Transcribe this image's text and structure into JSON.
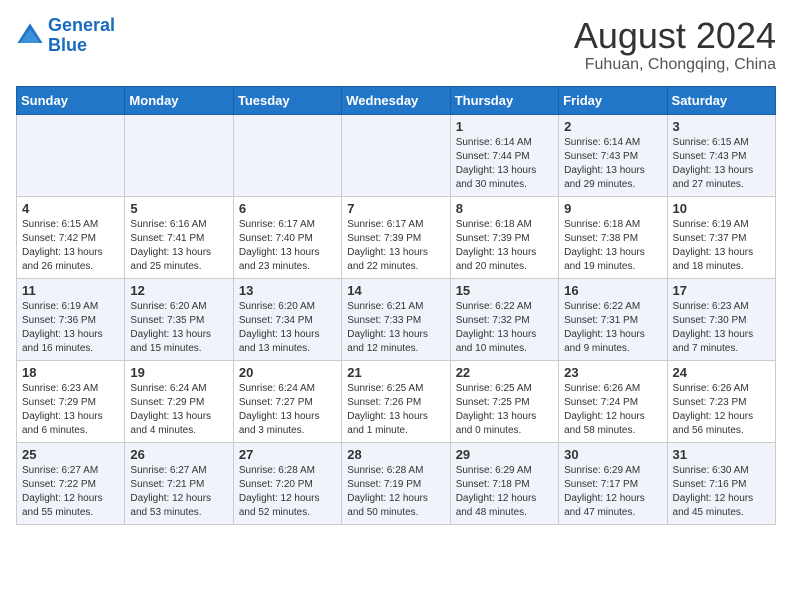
{
  "header": {
    "logo_line1": "General",
    "logo_line2": "Blue",
    "month_year": "August 2024",
    "location": "Fuhuan, Chongqing, China"
  },
  "weekdays": [
    "Sunday",
    "Monday",
    "Tuesday",
    "Wednesday",
    "Thursday",
    "Friday",
    "Saturday"
  ],
  "weeks": [
    [
      {
        "day": "",
        "info": ""
      },
      {
        "day": "",
        "info": ""
      },
      {
        "day": "",
        "info": ""
      },
      {
        "day": "",
        "info": ""
      },
      {
        "day": "1",
        "info": "Sunrise: 6:14 AM\nSunset: 7:44 PM\nDaylight: 13 hours\nand 30 minutes."
      },
      {
        "day": "2",
        "info": "Sunrise: 6:14 AM\nSunset: 7:43 PM\nDaylight: 13 hours\nand 29 minutes."
      },
      {
        "day": "3",
        "info": "Sunrise: 6:15 AM\nSunset: 7:43 PM\nDaylight: 13 hours\nand 27 minutes."
      }
    ],
    [
      {
        "day": "4",
        "info": "Sunrise: 6:15 AM\nSunset: 7:42 PM\nDaylight: 13 hours\nand 26 minutes."
      },
      {
        "day": "5",
        "info": "Sunrise: 6:16 AM\nSunset: 7:41 PM\nDaylight: 13 hours\nand 25 minutes."
      },
      {
        "day": "6",
        "info": "Sunrise: 6:17 AM\nSunset: 7:40 PM\nDaylight: 13 hours\nand 23 minutes."
      },
      {
        "day": "7",
        "info": "Sunrise: 6:17 AM\nSunset: 7:39 PM\nDaylight: 13 hours\nand 22 minutes."
      },
      {
        "day": "8",
        "info": "Sunrise: 6:18 AM\nSunset: 7:39 PM\nDaylight: 13 hours\nand 20 minutes."
      },
      {
        "day": "9",
        "info": "Sunrise: 6:18 AM\nSunset: 7:38 PM\nDaylight: 13 hours\nand 19 minutes."
      },
      {
        "day": "10",
        "info": "Sunrise: 6:19 AM\nSunset: 7:37 PM\nDaylight: 13 hours\nand 18 minutes."
      }
    ],
    [
      {
        "day": "11",
        "info": "Sunrise: 6:19 AM\nSunset: 7:36 PM\nDaylight: 13 hours\nand 16 minutes."
      },
      {
        "day": "12",
        "info": "Sunrise: 6:20 AM\nSunset: 7:35 PM\nDaylight: 13 hours\nand 15 minutes."
      },
      {
        "day": "13",
        "info": "Sunrise: 6:20 AM\nSunset: 7:34 PM\nDaylight: 13 hours\nand 13 minutes."
      },
      {
        "day": "14",
        "info": "Sunrise: 6:21 AM\nSunset: 7:33 PM\nDaylight: 13 hours\nand 12 minutes."
      },
      {
        "day": "15",
        "info": "Sunrise: 6:22 AM\nSunset: 7:32 PM\nDaylight: 13 hours\nand 10 minutes."
      },
      {
        "day": "16",
        "info": "Sunrise: 6:22 AM\nSunset: 7:31 PM\nDaylight: 13 hours\nand 9 minutes."
      },
      {
        "day": "17",
        "info": "Sunrise: 6:23 AM\nSunset: 7:30 PM\nDaylight: 13 hours\nand 7 minutes."
      }
    ],
    [
      {
        "day": "18",
        "info": "Sunrise: 6:23 AM\nSunset: 7:29 PM\nDaylight: 13 hours\nand 6 minutes."
      },
      {
        "day": "19",
        "info": "Sunrise: 6:24 AM\nSunset: 7:29 PM\nDaylight: 13 hours\nand 4 minutes."
      },
      {
        "day": "20",
        "info": "Sunrise: 6:24 AM\nSunset: 7:27 PM\nDaylight: 13 hours\nand 3 minutes."
      },
      {
        "day": "21",
        "info": "Sunrise: 6:25 AM\nSunset: 7:26 PM\nDaylight: 13 hours\nand 1 minute."
      },
      {
        "day": "22",
        "info": "Sunrise: 6:25 AM\nSunset: 7:25 PM\nDaylight: 13 hours\nand 0 minutes."
      },
      {
        "day": "23",
        "info": "Sunrise: 6:26 AM\nSunset: 7:24 PM\nDaylight: 12 hours\nand 58 minutes."
      },
      {
        "day": "24",
        "info": "Sunrise: 6:26 AM\nSunset: 7:23 PM\nDaylight: 12 hours\nand 56 minutes."
      }
    ],
    [
      {
        "day": "25",
        "info": "Sunrise: 6:27 AM\nSunset: 7:22 PM\nDaylight: 12 hours\nand 55 minutes."
      },
      {
        "day": "26",
        "info": "Sunrise: 6:27 AM\nSunset: 7:21 PM\nDaylight: 12 hours\nand 53 minutes."
      },
      {
        "day": "27",
        "info": "Sunrise: 6:28 AM\nSunset: 7:20 PM\nDaylight: 12 hours\nand 52 minutes."
      },
      {
        "day": "28",
        "info": "Sunrise: 6:28 AM\nSunset: 7:19 PM\nDaylight: 12 hours\nand 50 minutes."
      },
      {
        "day": "29",
        "info": "Sunrise: 6:29 AM\nSunset: 7:18 PM\nDaylight: 12 hours\nand 48 minutes."
      },
      {
        "day": "30",
        "info": "Sunrise: 6:29 AM\nSunset: 7:17 PM\nDaylight: 12 hours\nand 47 minutes."
      },
      {
        "day": "31",
        "info": "Sunrise: 6:30 AM\nSunset: 7:16 PM\nDaylight: 12 hours\nand 45 minutes."
      }
    ]
  ]
}
